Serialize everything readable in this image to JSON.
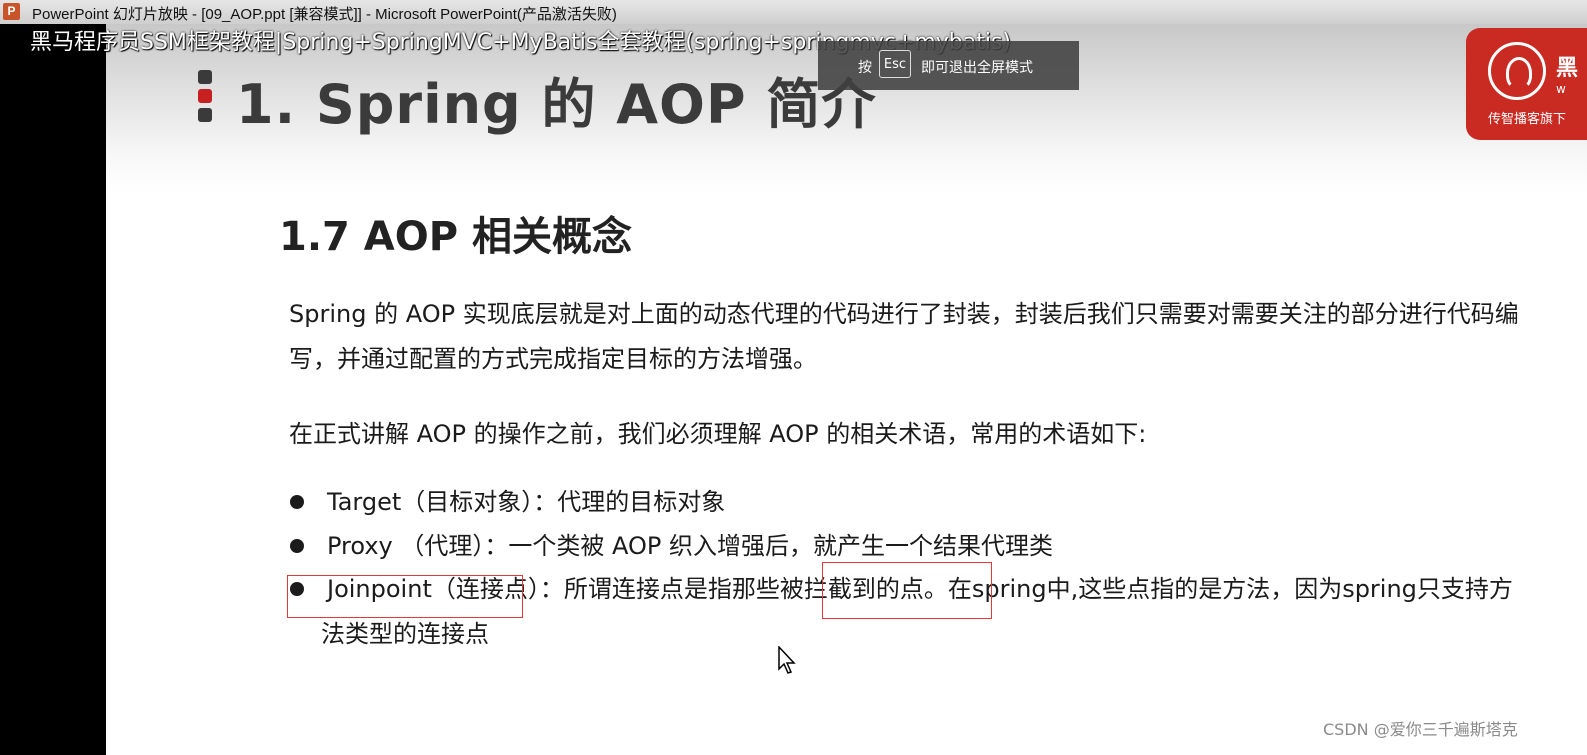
{
  "window": {
    "app_icon_letter": "P",
    "title": "PowerPoint 幻灯片放映 - [09_AOP.ppt [兼容模式]] - Microsoft PowerPoint(产品激活失败)"
  },
  "video_overlay_title": "黑马程序员SSM框架教程|Spring+SpringMVC+MyBatis全套教程(spring+springmvc+mybatis)",
  "slide": {
    "title": "1. Spring 的 AOP 简介",
    "logo": {
      "char": "黑",
      "small": "w",
      "tagline": "传智播客旗下"
    },
    "section_title": "1.7 AOP 相关概念",
    "paragraph1": "Spring 的 AOP 实现底层就是对上面的动态代理的代码进行了封装，封装后我们只需要对需要关注的部分进行代码编写，并通过配置的方式完成指定目标的方法增强。",
    "paragraph2": "在正式讲解 AOP 的操作之前，我们必须理解 AOP 的相关术语，常用的术语如下:",
    "bullets": [
      {
        "text": "Target（目标对象）：代理的目标对象"
      },
      {
        "text": "Proxy （代理）：一个类被 AOP 织入增强后，就产生一个结果代理类"
      },
      {
        "text": "Joinpoint（连接点）：所谓连接点是指那些被拦截到的点。在spring中,这些点指的是方法，因为spring只支持方",
        "text_cont": "法类型的连接点"
      }
    ]
  },
  "esc_notice": {
    "prefix": "按",
    "key": "Esc",
    "suffix": "即可退出全屏模式"
  },
  "watermark": "CSDN @爱你三千遍斯塔克",
  "colors": {
    "highlight_box": "#e53935",
    "logo_red": "#c92a22",
    "title_marker_red": "#c62020"
  }
}
